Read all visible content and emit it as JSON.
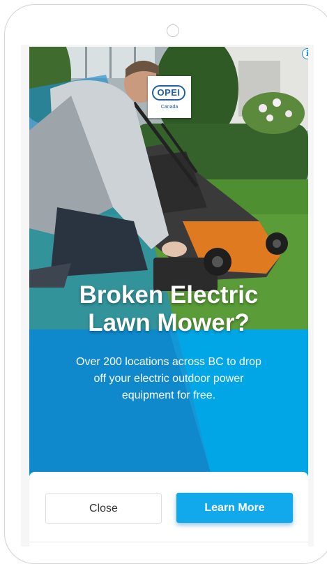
{
  "ad": {
    "headline_line1": "Broken Electric",
    "headline_line2": "Lawn Mower?",
    "body_line1": "Over 200 locations across BC to drop",
    "body_line2": "off your electric outdoor power",
    "body_line3": "equipment for free.",
    "info_icon": "i",
    "logo_mark": "OPEI",
    "logo_sub": "Canada",
    "accent_color": "#00a6e6"
  },
  "footer": {
    "close_label": "Close",
    "learn_more_label": "Learn More"
  },
  "icons": {
    "info": "info-icon",
    "speaker": "phone-speaker-icon"
  }
}
